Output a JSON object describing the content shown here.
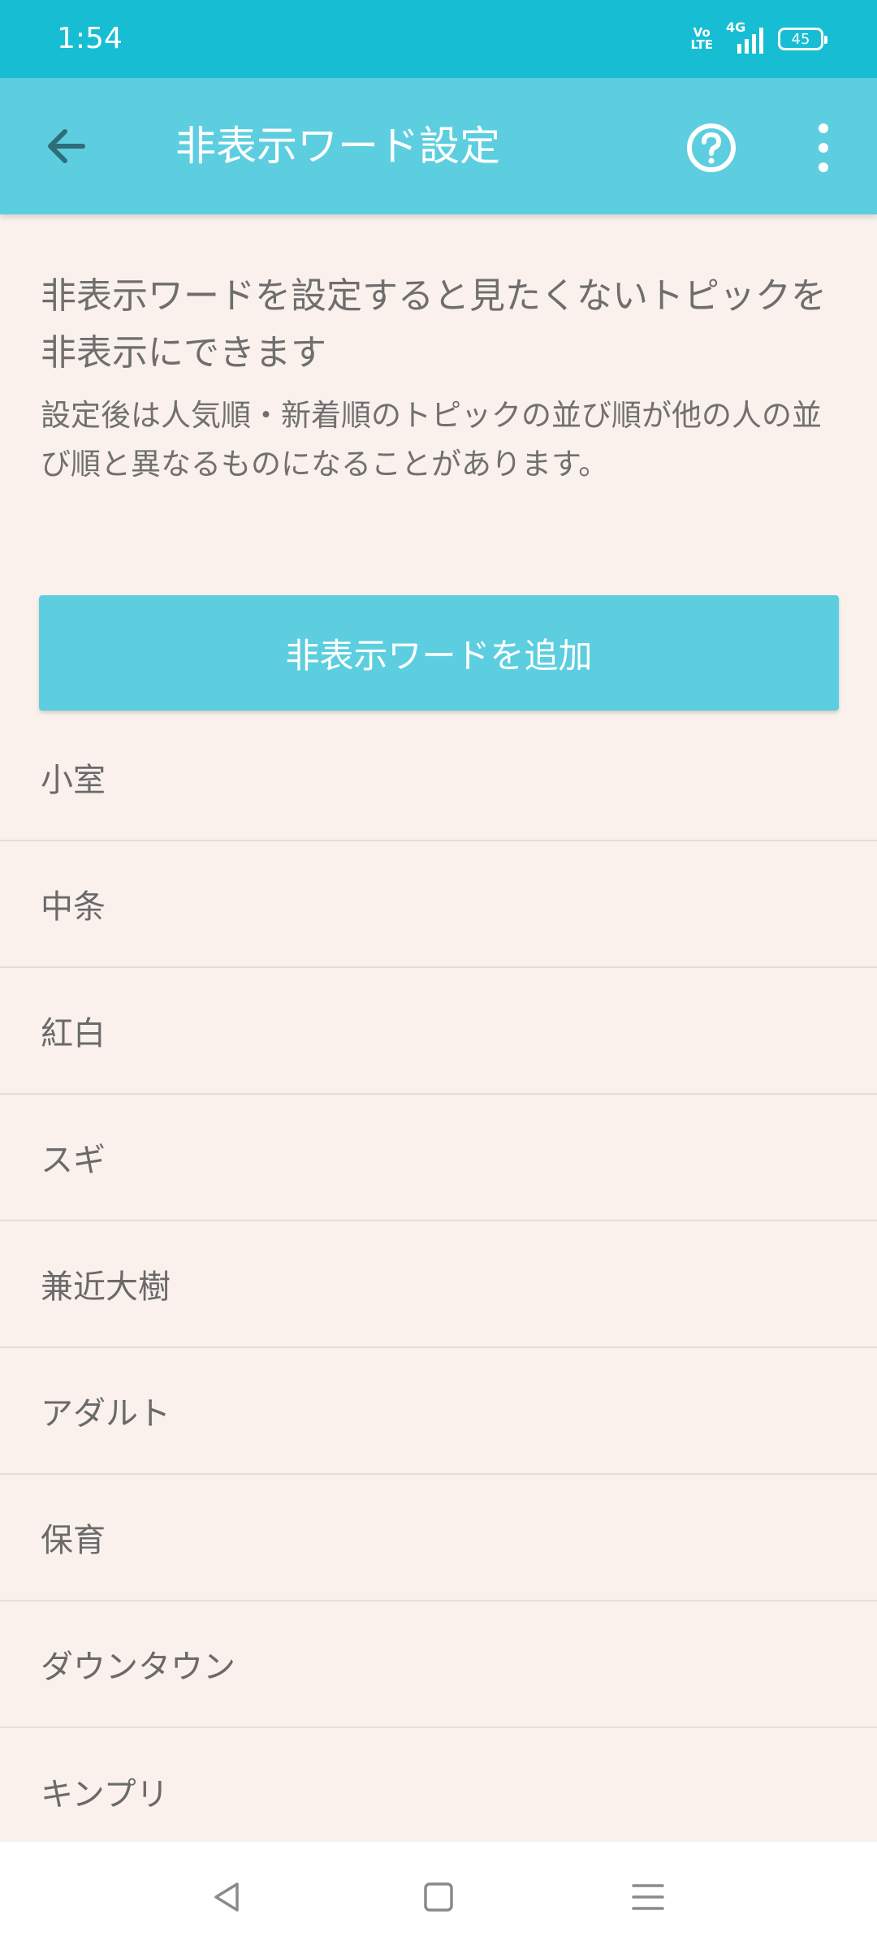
{
  "status_bar": {
    "time": "1:54",
    "volte_top": "Vo",
    "volte_bottom": "LTE",
    "network": "4G",
    "battery": "45"
  },
  "app_bar": {
    "title": "非表示ワード設定"
  },
  "intro": {
    "main_text": "非表示ワードを設定すると見たくないトピックを非表示にできます",
    "sub_text": "設定後は人気順・新着順のトピックの並び順が他の人の並び順と異なるものになることがあります。"
  },
  "add_button_label": "非表示ワードを追加",
  "hidden_words": [
    "小室",
    "中条",
    "紅白",
    "スギ",
    "兼近大樹",
    "アダルト",
    "保育",
    "ダウンタウン",
    "キンプリ"
  ],
  "colors": {
    "status_bar": "#17BED3",
    "app_bar": "#5CCEDF",
    "background": "#FAF1EC",
    "accent": "#5CCEDF"
  },
  "icons": {
    "back": "arrow-left-icon",
    "help": "help-circle-icon",
    "more": "more-vertical-icon",
    "nav_back": "triangle-back-icon",
    "nav_home": "square-home-icon",
    "nav_menu": "menu-lines-icon"
  }
}
